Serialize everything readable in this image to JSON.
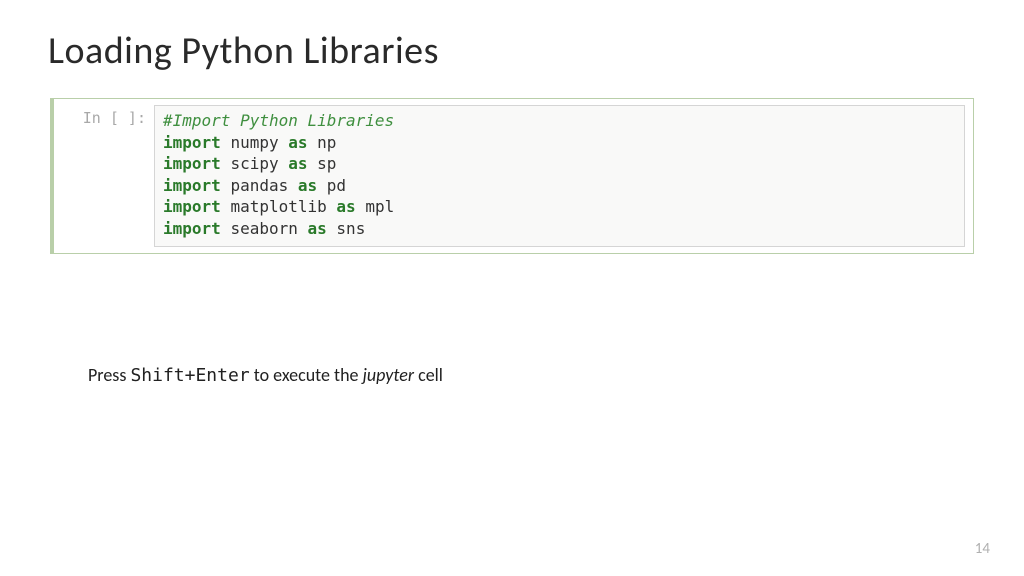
{
  "title": "Loading Python Libraries",
  "cell": {
    "prompt": "In [ ]:",
    "code": {
      "comment": "#Import Python Libraries",
      "lines": [
        {
          "kw1": "import",
          "mod": "numpy",
          "kw2": "as",
          "alias": "np"
        },
        {
          "kw1": "import",
          "mod": "scipy",
          "kw2": "as",
          "alias": "sp"
        },
        {
          "kw1": "import",
          "mod": "pandas",
          "kw2": "as",
          "alias": "pd"
        },
        {
          "kw1": "import",
          "mod": "matplotlib",
          "kw2": "as",
          "alias": "mpl"
        },
        {
          "kw1": "import",
          "mod": "seaborn",
          "kw2": "as",
          "alias": "sns"
        }
      ]
    }
  },
  "instruction": {
    "pre": "Press ",
    "key": "Shift+Enter",
    "mid": " to execute the ",
    "ital": "jupyter",
    "post": " cell"
  },
  "page_number": "14"
}
